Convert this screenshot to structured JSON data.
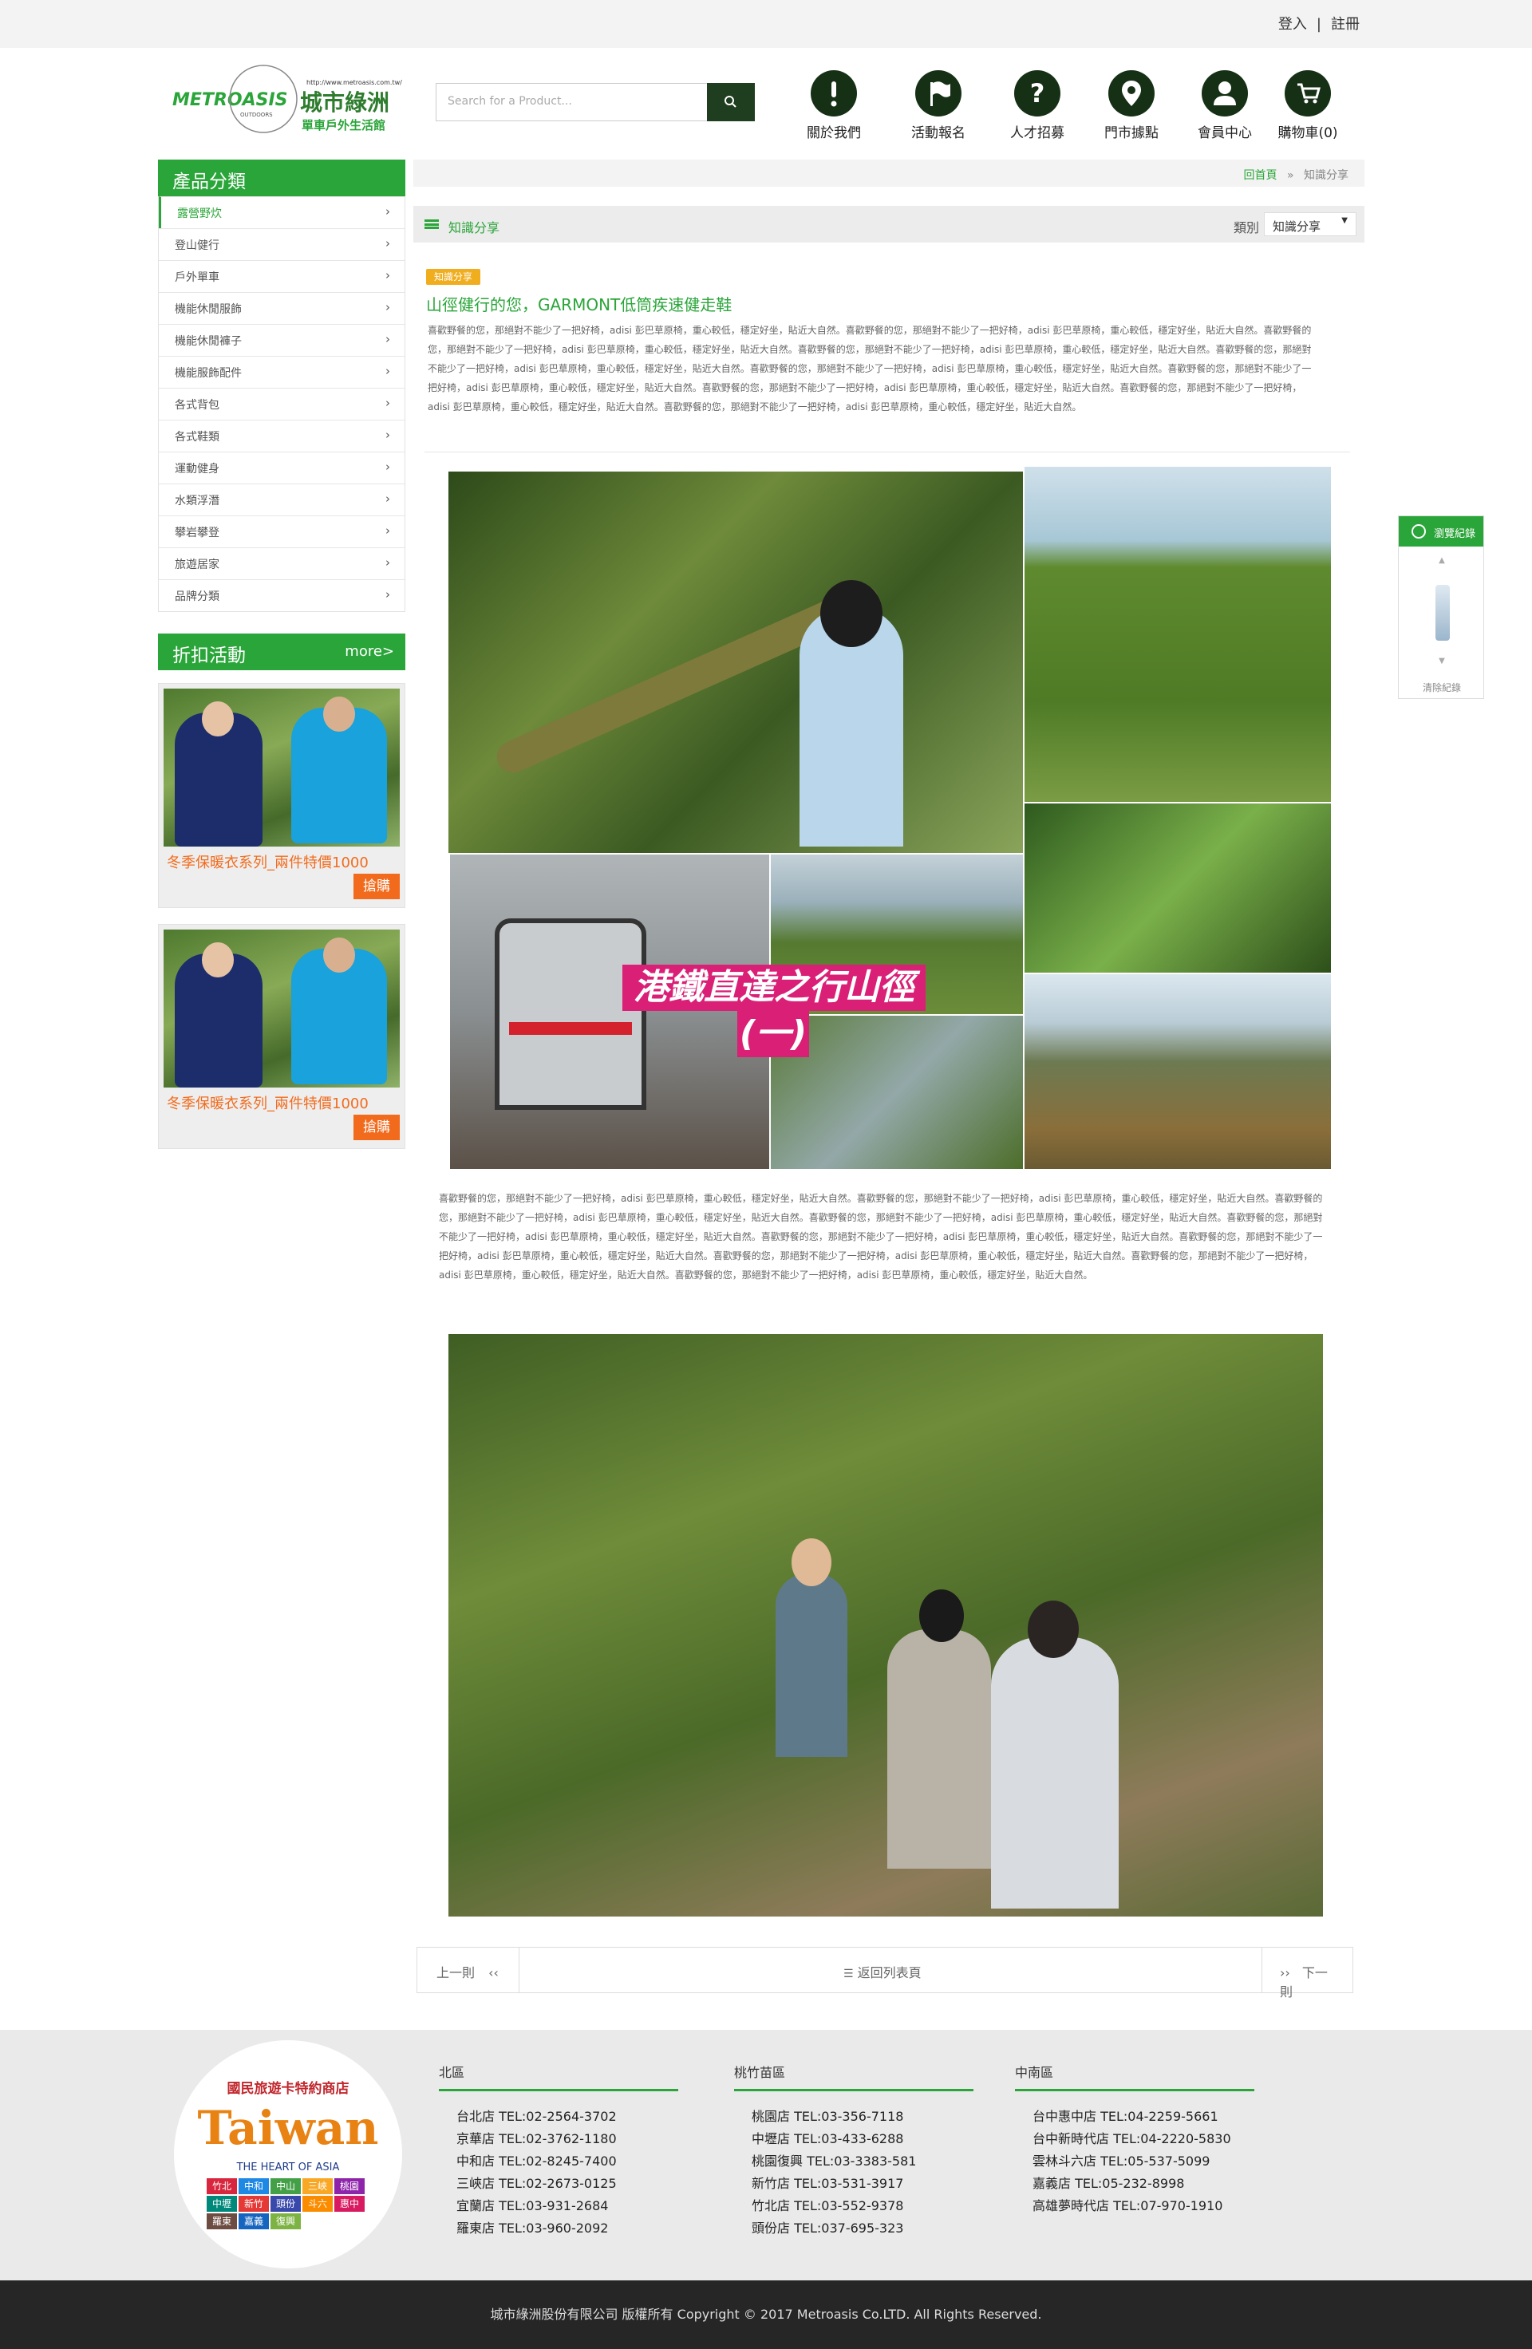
{
  "header": {
    "login": "登入",
    "register": "註冊",
    "logo": {
      "brand": "METROASIS",
      "brand_small": "OUTDOORS",
      "url": "http://www.metroasis.com.tw/",
      "cn_name": "城市綠洲",
      "cn_sub": "單車戶外生活館"
    },
    "search_placeholder": "Search for a Product...",
    "nav": [
      {
        "label": "關於我們",
        "icon": "exclamation-icon"
      },
      {
        "label": "活動報名",
        "icon": "flag-icon"
      },
      {
        "label": "人才招募",
        "icon": "question-icon"
      },
      {
        "label": "門市據點",
        "icon": "location-pin-icon"
      },
      {
        "label": "會員中心",
        "icon": "user-icon"
      },
      {
        "label": "購物車(0)",
        "icon": "cart-icon"
      }
    ]
  },
  "sidebar": {
    "categories_title": "產品分類",
    "categories": [
      "露營野炊",
      "登山健行",
      "戶外單車",
      "機能休閒服飾",
      "機能休閒褲子",
      "機能服飾配件",
      "各式背包",
      "各式鞋類",
      "運動健身",
      "水類浮潛",
      "攀岩攀登",
      "旅遊居家",
      "品牌分類"
    ],
    "active_category": "露營野炊",
    "promo_title": "折扣活動",
    "promo_more": "more>",
    "promos": [
      {
        "title": "冬季保暖衣系列_兩件特價1000",
        "button": "搶購"
      },
      {
        "title": "冬季保暖衣系列_兩件特價1000",
        "button": "搶購"
      }
    ]
  },
  "breadcrumb": {
    "home": "回首頁",
    "sep": "»",
    "current": "知識分享"
  },
  "listbar": {
    "title": "知識分享",
    "category_label": "類別",
    "category_value": "知識分享"
  },
  "article": {
    "tag": "知識分享",
    "title": "山徑健行的您，GARMONT低筒疾速健走鞋",
    "intro": "喜歡野餐的您，那絕對不能少了一把好椅，adisi 彭巴草原椅，重心較低，穩定好坐，貼近大自然。喜歡野餐的您，那絕對不能少了一把好椅，adisi 彭巴草原椅，重心較低，穩定好坐，貼近大自然。喜歡野餐的您，那絕對不能少了一把好椅，adisi 彭巴草原椅，重心較低，穩定好坐，貼近大自然。喜歡野餐的您，那絕對不能少了一把好椅，adisi 彭巴草原椅，重心較低，穩定好坐，貼近大自然。喜歡野餐的您，那絕對不能少了一把好椅，adisi 彭巴草原椅，重心較低，穩定好坐，貼近大自然。喜歡野餐的您，那絕對不能少了一把好椅，adisi 彭巴草原椅，重心較低，穩定好坐，貼近大自然。喜歡野餐的您，那絕對不能少了一把好椅，adisi 彭巴草原椅，重心較低，穩定好坐，貼近大自然。喜歡野餐的您，那絕對不能少了一把好椅，adisi 彭巴草原椅，重心較低，穩定好坐，貼近大自然。喜歡野餐的您，那絕對不能少了一把好椅，adisi 彭巴草原椅，重心較低，穩定好坐，貼近大自然。喜歡野餐的您，那絕對不能少了一把好椅，adisi 彭巴草原椅，重心較低，穩定好坐，貼近大自然。",
    "collage_banner_line1": "港鐵直達之行山徑",
    "collage_banner_line2": "(一)",
    "body": "喜歡野餐的您，那絕對不能少了一把好椅，adisi 彭巴草原椅，重心較低，穩定好坐，貼近大自然。喜歡野餐的您，那絕對不能少了一把好椅，adisi 彭巴草原椅，重心較低，穩定好坐，貼近大自然。喜歡野餐的您，那絕對不能少了一把好椅，adisi 彭巴草原椅，重心較低，穩定好坐，貼近大自然。喜歡野餐的您，那絕對不能少了一把好椅，adisi 彭巴草原椅，重心較低，穩定好坐，貼近大自然。喜歡野餐的您，那絕對不能少了一把好椅，adisi 彭巴草原椅，重心較低，穩定好坐，貼近大自然。喜歡野餐的您，那絕對不能少了一把好椅，adisi 彭巴草原椅，重心較低，穩定好坐，貼近大自然。喜歡野餐的您，那絕對不能少了一把好椅，adisi 彭巴草原椅，重心較低，穩定好坐，貼近大自然。喜歡野餐的您，那絕對不能少了一把好椅，adisi 彭巴草原椅，重心較低，穩定好坐，貼近大自然。喜歡野餐的您，那絕對不能少了一把好椅，adisi 彭巴草原椅，重心較低，穩定好坐，貼近大自然。喜歡野餐的您，那絕對不能少了一把好椅，adisi 彭巴草原椅，重心較低，穩定好坐，貼近大自然。"
  },
  "pager": {
    "prev": "上一則",
    "prev_icon": "‹‹",
    "back": "返回列表頁",
    "next": "下一則",
    "next_icon": "››"
  },
  "history": {
    "title": "瀏覽紀錄",
    "clear": "清除紀錄"
  },
  "footer": {
    "badge": {
      "arc_text": "國民旅遊卡特約商店",
      "word": "Taiwan",
      "subtitle": "THE HEART OF ASIA",
      "stores": [
        "竹北",
        "中和",
        "中山",
        "三峽",
        "桃園",
        "中壢",
        "新竹",
        "頭份",
        "斗六",
        "惠中",
        "羅東",
        "嘉義",
        "復興"
      ]
    },
    "columns": [
      {
        "title": "北區",
        "rows": [
          "台北店 TEL:02-2564-3702",
          "京華店 TEL:02-3762-1180",
          "中和店 TEL:02-8245-7400",
          "三峽店 TEL:02-2673-0125",
          "宜蘭店 TEL:03-931-2684",
          "羅東店 TEL:03-960-2092"
        ]
      },
      {
        "title": "桃竹苗區",
        "rows": [
          "桃園店 TEL:03-356-7118",
          "中壢店 TEL:03-433-6288",
          "桃園復興 TEL:03-3383-581",
          "新竹店 TEL:03-531-3917",
          "竹北店 TEL:03-552-9378",
          "頭份店 TEL:037-695-323"
        ]
      },
      {
        "title": "中南區",
        "rows": [
          "台中惠中店 TEL:04-2259-5661",
          "台中新時代店 TEL:04-2220-5830",
          "雲林斗六店 TEL:05-537-5099",
          "嘉義店 TEL:05-232-8998",
          "高雄夢時代店 TEL:07-970-1910"
        ]
      }
    ],
    "copyright": "城市綠洲股份有限公司 版權所有 Copyright © 2017 Metroasis Co.LTD. All Rights Reserved."
  },
  "colors": {
    "accent": "#2aa539",
    "dark_icon": "#163016",
    "promo": "#f26b1d",
    "tag": "#f0ad1e",
    "banner": "#d91f76"
  }
}
